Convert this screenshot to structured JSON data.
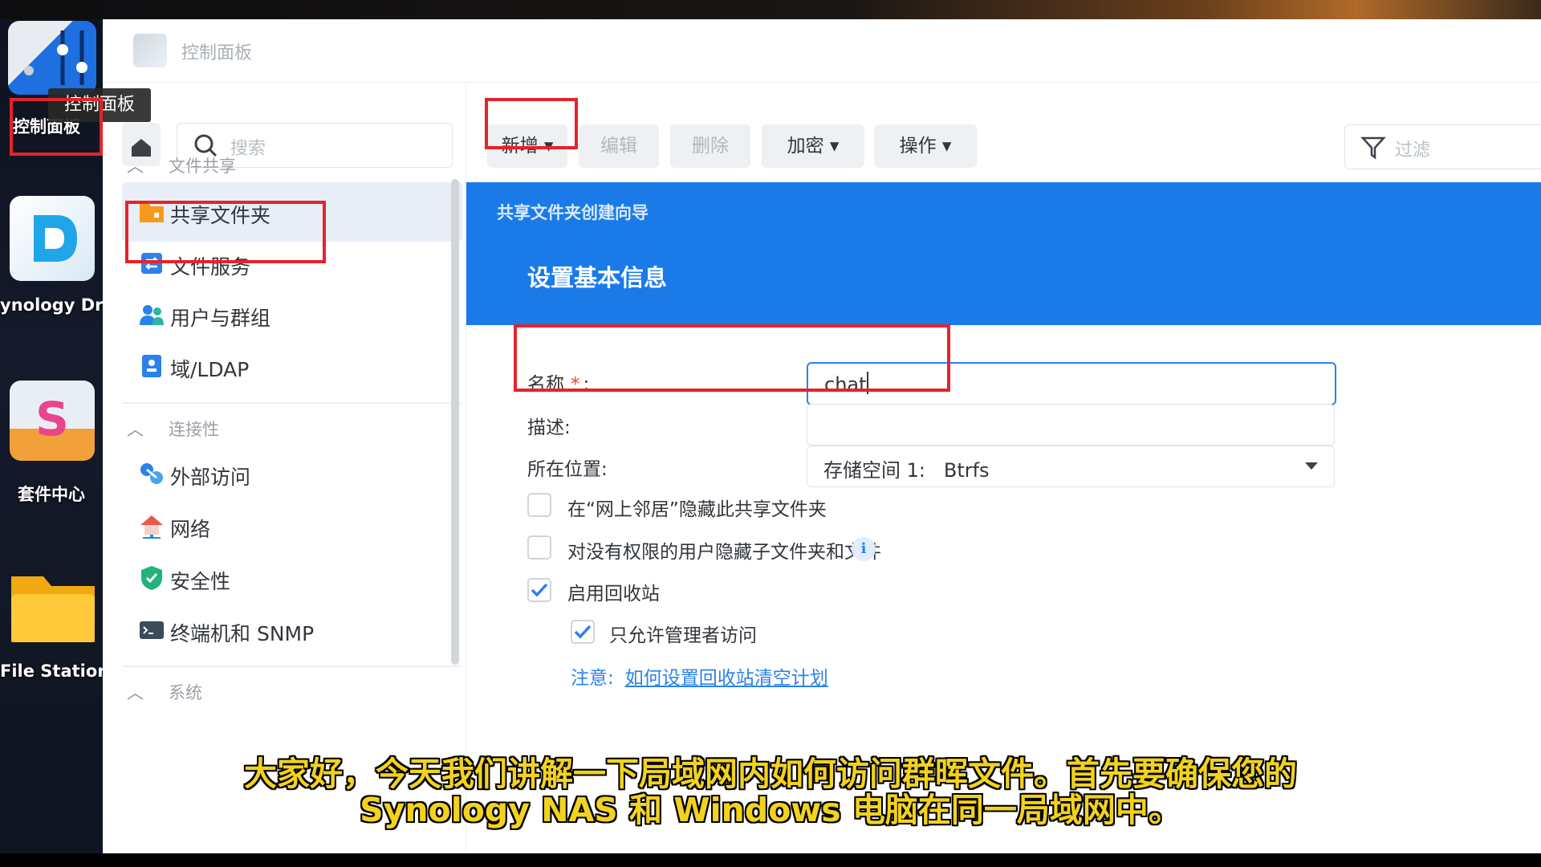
{
  "desktop": {
    "items": [
      {
        "label": "控制面板"
      },
      {
        "label": "ynology Dri"
      },
      {
        "label": "套件中心"
      },
      {
        "label": "File Station"
      }
    ],
    "tooltip": "控制面板"
  },
  "window": {
    "title": "控制面板"
  },
  "sidebar": {
    "search_placeholder": "搜索",
    "sections": [
      {
        "label": "文件共享",
        "items": [
          {
            "label": "共享文件夹",
            "icon": "shared-folder-icon",
            "active": true
          },
          {
            "label": "文件服务",
            "icon": "file-services-icon"
          },
          {
            "label": "用户与群组",
            "icon": "users-groups-icon"
          },
          {
            "label": "域/LDAP",
            "icon": "domain-ldap-icon"
          }
        ]
      },
      {
        "label": "连接性",
        "items": [
          {
            "label": "外部访问",
            "icon": "external-access-icon"
          },
          {
            "label": "网络",
            "icon": "network-icon"
          },
          {
            "label": "安全性",
            "icon": "security-icon"
          },
          {
            "label": "终端机和 SNMP",
            "icon": "terminal-icon"
          }
        ]
      },
      {
        "label": "系统",
        "items": []
      }
    ]
  },
  "toolbar": {
    "create": "新增 ▾",
    "edit": "编辑",
    "delete": "删除",
    "encrypt": "加密 ▾",
    "action": "操作 ▾",
    "filter_placeholder": "过滤"
  },
  "wizard": {
    "title": "共享文件夹创建向导",
    "step": "设置基本信息",
    "name_label": "名称",
    "required_mark": "*",
    "name_colon": ":",
    "name_value": "chat",
    "desc_label": "描述:",
    "desc_value": "",
    "location_label": "所在位置:",
    "location_value": "存储空间 1:   Btrfs",
    "options": [
      {
        "label": "在“网上邻居”隐藏此共享文件夹",
        "checked": false
      },
      {
        "label": "对没有权限的用户隐藏子文件夹和文件",
        "checked": false,
        "info": "i"
      },
      {
        "label": "启用回收站",
        "checked": true
      },
      {
        "label": "只允许管理者访问",
        "checked": true
      }
    ],
    "note_label": "注意:",
    "note_link": "如何设置回收站清空计划"
  },
  "subtitle": {
    "line1": "大家好，今天我们讲解一下局域网内如何访问群晖文件。首先要确保您的",
    "line2": "Synology NAS 和 Windows 电脑在同一局域网中。"
  },
  "colors": {
    "accent": "#1a7be8",
    "highlight": "#e5232a",
    "subtitle": "#f2d21e"
  }
}
